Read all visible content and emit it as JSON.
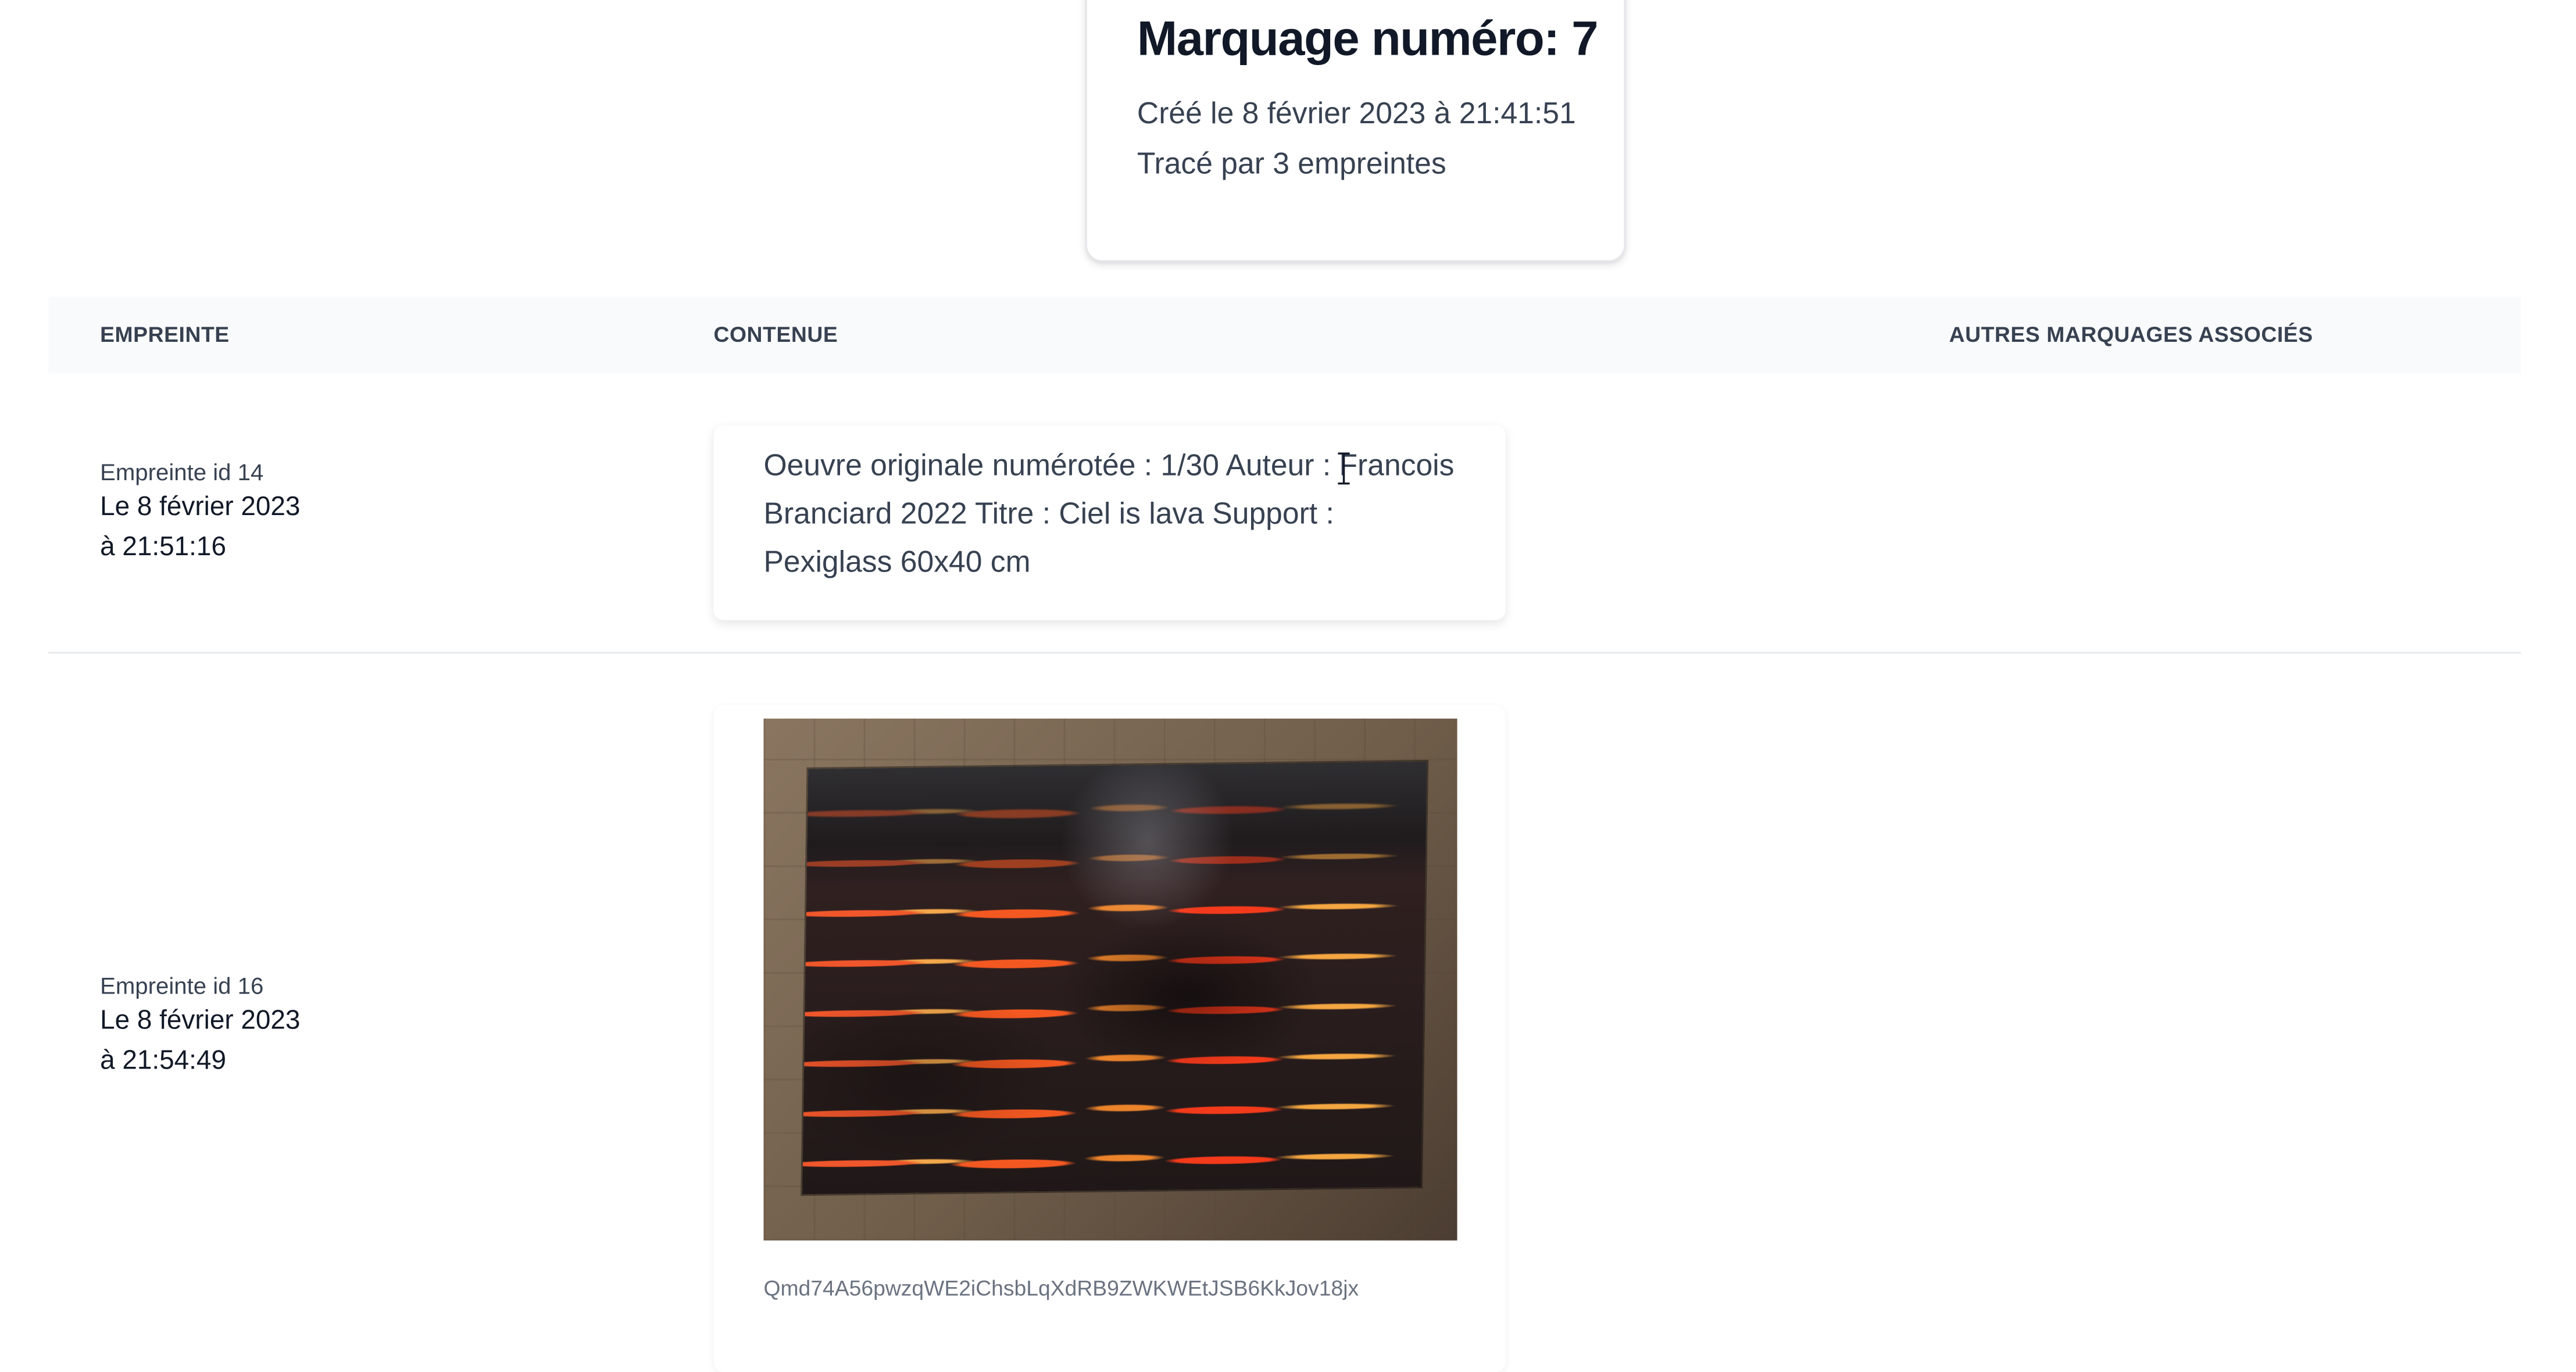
{
  "summary": {
    "title": "Marquage numéro: 7",
    "created": "Créé le 8 février 2023 à 21:41:51",
    "traced": "Tracé par 3 empreintes"
  },
  "table": {
    "headers": [
      "EMPREINTE",
      "CONTENUE",
      "AUTRES MARQUAGES ASSOCIÉS"
    ],
    "rows": [
      {
        "id_label": "Empreinte id 14",
        "date": "Le 8 février 2023",
        "time": "à 21:51:16",
        "content_text": "Oeuvre originale numérotée : 1/30 Auteur : Francois Branciard 2022 Titre : Ciel is lava Support : Pexiglass 60x40 cm",
        "associated": ""
      },
      {
        "id_label": "Empreinte id 16",
        "date": "Le 8 février 2023",
        "time": "à 21:54:49",
        "image": "red cloud sky print photo",
        "hash": "Qmd74A56pwzqWE2iChsbLqXdRB9ZWKWEtJSB6KkJov18jx",
        "associated": ""
      }
    ]
  },
  "ui": {
    "cursor_icon": "text-cursor-icon",
    "colors": {
      "text": "#1f2937",
      "muted": "#6b7280",
      "header_bg": "#f9fafb",
      "divider": "#e5e7eb"
    }
  }
}
